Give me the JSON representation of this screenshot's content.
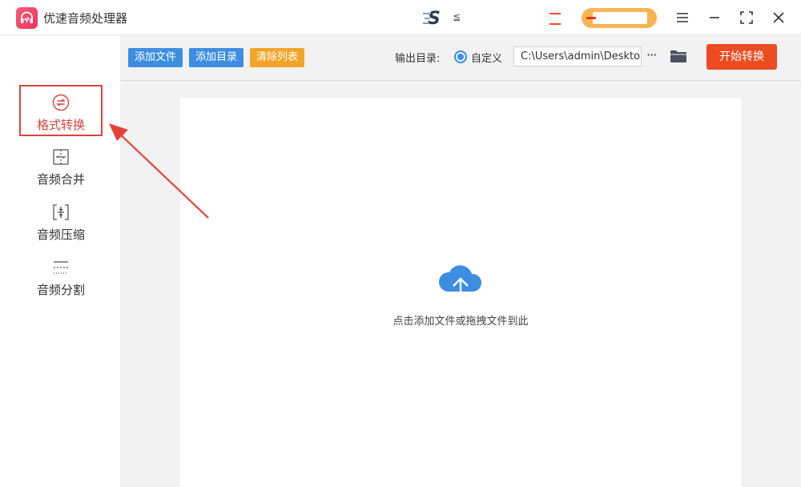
{
  "app": {
    "title": "优速音频处理器",
    "icon": "headphones-icon"
  },
  "window_controls": [
    "menu-icon",
    "minimize-icon",
    "maximize-icon",
    "close-icon"
  ],
  "sidebar": {
    "items": [
      {
        "label": "格式转换",
        "icon": "convert-icon",
        "active": true
      },
      {
        "label": "音频合并",
        "icon": "merge-icon",
        "active": false
      },
      {
        "label": "音频压缩",
        "icon": "compress-icon",
        "active": false
      },
      {
        "label": "音频分割",
        "icon": "split-icon",
        "active": false
      }
    ]
  },
  "toolbar": {
    "add_file": "添加文件",
    "add_folder": "添加目录",
    "clear_list": "清除列表",
    "output_label": "输出目录:",
    "custom_label": "自定义",
    "output_path": "C:\\Users\\admin\\Deskto",
    "more": "···",
    "start": "开始转换"
  },
  "main": {
    "drop_hint": "点击添加文件或拖拽文件到此"
  },
  "colors": {
    "accent_blue": "#3d8ee0",
    "accent_orange": "#f1a52a",
    "start_red": "#ee4b22",
    "highlight_red": "#d9453d"
  }
}
